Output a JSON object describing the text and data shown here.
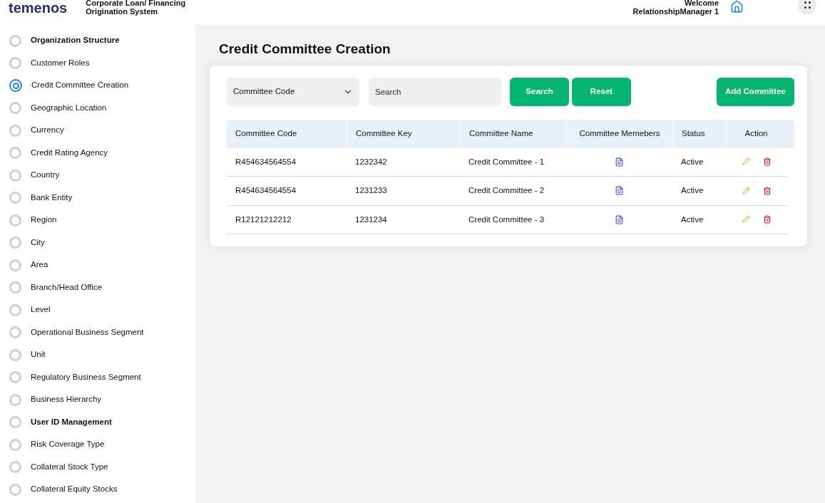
{
  "header": {
    "logo": "temenos",
    "app_title": [
      "Corporate Loan/ Financing",
      "Origination System"
    ],
    "welcome": [
      "Welcome",
      "RelationshipManager 1"
    ]
  },
  "sidebar": {
    "items": [
      {
        "label": "Organization Structure",
        "bold": true,
        "selected": false
      },
      {
        "label": "Customer Roles",
        "bold": false,
        "selected": false
      },
      {
        "label": "Credit  Committee Creation",
        "bold": false,
        "selected": true
      },
      {
        "label": "Geographic Location",
        "bold": false,
        "selected": false
      },
      {
        "label": "Currency",
        "bold": false,
        "selected": false
      },
      {
        "label": "Credit Rating Agency",
        "bold": false,
        "selected": false
      },
      {
        "label": "Country",
        "bold": false,
        "selected": false
      },
      {
        "label": "Bank Entity",
        "bold": false,
        "selected": false
      },
      {
        "label": "Region",
        "bold": false,
        "selected": false
      },
      {
        "label": "City",
        "bold": false,
        "selected": false
      },
      {
        "label": "Area",
        "bold": false,
        "selected": false
      },
      {
        "label": "Branch/Head Office",
        "bold": false,
        "selected": false
      },
      {
        "label": "Level",
        "bold": false,
        "selected": false
      },
      {
        "label": "Operational Business Segment",
        "bold": false,
        "selected": false
      },
      {
        "label": "Unit",
        "bold": false,
        "selected": false
      },
      {
        "label": "Regulatory Business Segment",
        "bold": false,
        "selected": false
      },
      {
        "label": "Business Hierarchy",
        "bold": false,
        "selected": false
      },
      {
        "label": "User ID Management",
        "bold": true,
        "selected": false
      },
      {
        "label": "Risk Coverage Type",
        "bold": false,
        "selected": false
      },
      {
        "label": "Collateral Stock Type",
        "bold": false,
        "selected": false
      },
      {
        "label": "Collateral Equity Stocks",
        "bold": false,
        "selected": false
      }
    ]
  },
  "page_title": "Credit Committee Creation",
  "filters": {
    "dropdown": "Committee Code",
    "search_placeholder": "Search",
    "buttons": [
      "Search",
      "Reset"
    ],
    "add_button": "Add Committee"
  },
  "table": {
    "columns": [
      "Committee Code",
      "Committee Key",
      "Committee Name",
      "Committee Memebers",
      "Status",
      "Action"
    ],
    "rows": [
      {
        "code": "R454634564554",
        "key": "1232342",
        "name": "Credit Committee - 1",
        "status": "Active"
      },
      {
        "code": "R454634564554",
        "key": "1231233",
        "name": "Credit Committee - 2",
        "status": "Active"
      },
      {
        "code": "R12121212212",
        "key": "1231234",
        "name": "Credit Committee - 3",
        "status": "Active"
      }
    ]
  }
}
